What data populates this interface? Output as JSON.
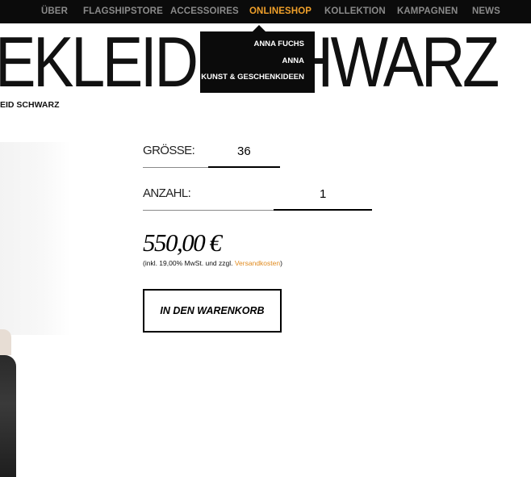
{
  "nav": {
    "items": [
      {
        "label": "ÜBER"
      },
      {
        "label": "FLAGSHIPSTORE"
      },
      {
        "label": "ACCESSOIRES"
      },
      {
        "label": "ONLINESHOP"
      },
      {
        "label": "KOLLEKTION"
      },
      {
        "label": "KAMPAGNEN"
      },
      {
        "label": "NEWS"
      }
    ],
    "active": "ONLINESHOP",
    "active_color": "#f0a02a",
    "dropdown": [
      {
        "label": "ANNA FUCHS"
      },
      {
        "label": "ANNA"
      },
      {
        "label": "KUNST & GESCHENKIDEEN"
      }
    ]
  },
  "product": {
    "title": "EKLEID SCHWARZ",
    "breadcrumb": "EID SCHWARZ",
    "size_label": "GRÖSSE:",
    "size_value": "36",
    "qty_label": "ANZAHL:",
    "qty_value": "1",
    "price": "550,00 €",
    "tax_prefix": "(inkl. 19,00% MwSt. und zzgl. ",
    "tax_link": "Versandkosten",
    "tax_suffix": ")",
    "link_color": "#e08a1e",
    "cart_button": "IN DEN WARENKORB"
  }
}
